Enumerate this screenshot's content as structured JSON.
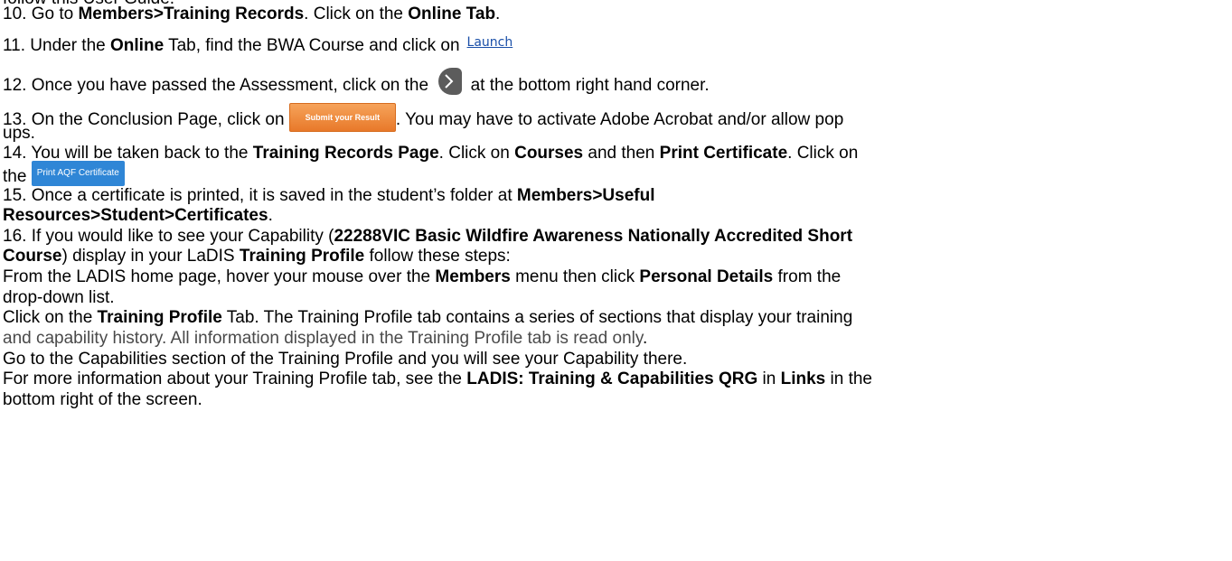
{
  "lines": {
    "l0": "follow this User Guide.",
    "l10a": "10. Go to ",
    "l10b": "Members>Training Records",
    "l10c": ". Click on the ",
    "l10d": "Online Tab",
    "l10e": ".",
    "l11a": "11.  Under the ",
    "l11b": "Online",
    "l11c": " Tab, find the BWA Course and click on",
    "l12a": "12.  Once you have passed the Assessment, click on the ",
    "l12b": " at the bottom right hand corner.",
    "l13a": "13. On the Conclusion Page, click on ",
    "l13b": ". You may have to activate Adobe Acrobat and/or allow pop",
    "l13c": "ups.",
    "l14a": "14. You will be taken back to the ",
    "l14b": "Training Records Page",
    "l14c": ".  Click on ",
    "l14d": "Courses",
    "l14e": " and then ",
    "l14f": "Print Certificate",
    "l14g": ".  Click on",
    "l14h": "the",
    "l15a": "15. Once a certificate is printed, it is saved in the student’s folder at ",
    "l15b": "Members>Useful",
    "l15c": "Resources>Student>Certificates",
    "l15d": ".",
    "l16a": "16. If you would like to see your Capability (",
    "l16b": "22288VIC Basic Wildfire Awareness Nationally Accredited Short",
    "l16c": "Course",
    "l16d": ") display in your LaDIS ",
    "l16e": "Training Profile",
    "l16f": " follow these steps:",
    "p1a": "From the LADIS home page, hover your mouse over the ",
    "p1b": "Members",
    "p1c": " menu then click ",
    "p1d": "Personal Details",
    "p1e": " from the",
    "p1f": "drop-down list.",
    "p2a": "Click on the ",
    "p2b": "Training Profile",
    "p2c": " Tab.  The Training Profile tab contains a series of sections that display your training",
    "p2d": "and capability history.  All information displayed in the Training Profile tab is read only",
    "p2e": ".",
    "p3": "Go to the Capabilities section of the Training Profile and you will see your Capability there.",
    "p4a": "For more information about your Training Profile tab, see the ",
    "p4b": "LADIS: Training & Capabilities QRG",
    "p4c": " in ",
    "p4d": "Links",
    "p4e": " in the",
    "p4f": "bottom right of the screen."
  },
  "ui": {
    "launch_link": "Launch",
    "submit_button": "Submit your Result",
    "print_button": "Print AQF Certificate",
    "next_icon": "chevron-right-icon"
  }
}
